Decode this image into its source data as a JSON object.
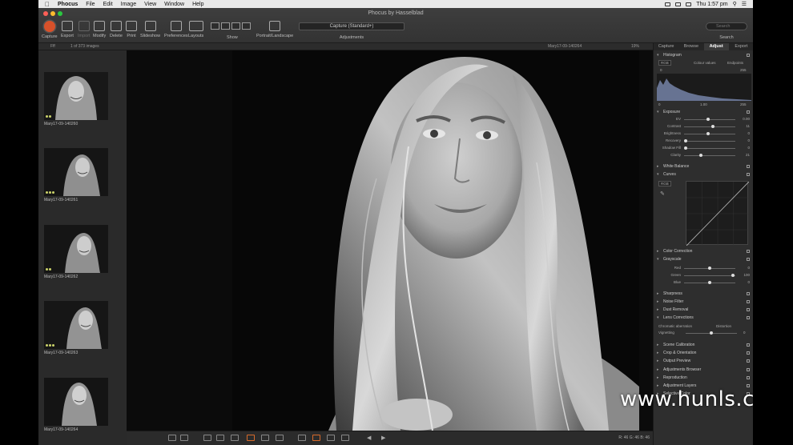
{
  "menubar": {
    "apple": "",
    "app": "Phocus",
    "items": [
      "File",
      "Edit",
      "Image",
      "View",
      "Window",
      "Help"
    ],
    "clock": "Thu 1:57 pm"
  },
  "window": {
    "title": "Phocus by Hasselblad"
  },
  "toolbar": {
    "tools": [
      "Capture",
      "Export",
      "Import",
      "Modify",
      "Delete",
      "Print",
      "Slideshow",
      "Preferences",
      "Layouts"
    ],
    "show_label": "Show",
    "portrait_label": "Portrait/Landscape",
    "adjustments_value": "Capture (Standard+)",
    "adjustments_label": "Adjustments",
    "search_placeholder": "Search",
    "search_label": "Search"
  },
  "infostrip": {
    "filter": "Fff",
    "count": "1 of 373 images",
    "filename": "Mary17-09-140264",
    "zoom": "19%"
  },
  "thumbnails": [
    {
      "name": "Mary17-09-140260"
    },
    {
      "name": "Mary17-09-140261"
    },
    {
      "name": "Mary17-09-140262"
    },
    {
      "name": "Mary17-09-140263"
    },
    {
      "name": "Mary17-09-140264"
    }
  ],
  "bottombar": {
    "coords": "R: 46  G: 46  B: 46"
  },
  "panel": {
    "tabs": [
      "Capture",
      "Browse",
      "Adjust",
      "Export"
    ],
    "active_tab": "Adjust",
    "histogram": {
      "title": "Histogram",
      "channel": "RGB",
      "clip_label": "Colour values",
      "snap_label": "Endpoints",
      "left": "0",
      "mid": "1.00",
      "right": "255",
      "top_right": "255"
    },
    "exposure": {
      "title": "Exposure",
      "rows": [
        {
          "label": "EV",
          "value": "0.00",
          "pos": 0.45
        },
        {
          "label": "Contrast",
          "value": "11",
          "pos": 0.55
        },
        {
          "label": "Brightness",
          "value": "0",
          "pos": 0.45
        },
        {
          "label": "Recovery",
          "value": "0",
          "pos": 0.0
        },
        {
          "label": "Shadow Fill",
          "value": "0",
          "pos": 0.0
        },
        {
          "label": "Clarity",
          "value": "21",
          "pos": 0.3
        }
      ]
    },
    "white_balance": "White Balance",
    "curves": {
      "title": "Curves",
      "channel": "RGB"
    },
    "color_correction": "Color Correction",
    "grayscale": {
      "title": "Grayscale",
      "rows": [
        {
          "label": "Red",
          "value": "0",
          "pos": 0.48
        },
        {
          "label": "Green",
          "value": "100",
          "pos": 0.95
        },
        {
          "label": "Blue",
          "value": "0",
          "pos": 0.48
        }
      ]
    },
    "sections_after": [
      "Sharpness",
      "Noise Filter",
      "Dust Removal",
      "Lens Corrections"
    ],
    "lens": {
      "chromatic": "Chromatic aberration",
      "distortion": "Distortion",
      "vignetting": "Vignetting",
      "vignetting_value": "0"
    },
    "sections_tail": [
      "Scene Calibration",
      "Crop & Orientation",
      "Output Preview",
      "Adjustments Browser",
      "Reproduction",
      "Adjustment Layers",
      "Selective Color"
    ]
  },
  "watermark": "www.hunls.com"
}
